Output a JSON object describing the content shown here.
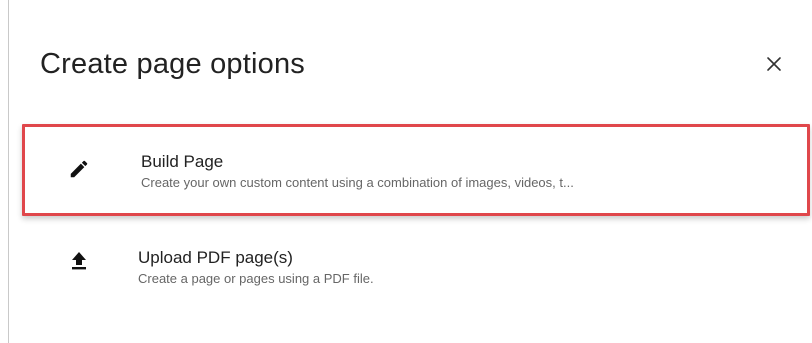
{
  "dialog": {
    "title": "Create page options",
    "close_icon": "close-icon"
  },
  "options": [
    {
      "label": "Build Page",
      "description": "Create your own custom content using a combination of images, videos, t...",
      "icon": "pencil-icon",
      "highlighted": true
    },
    {
      "label": "Upload PDF page(s)",
      "description": "Create a page or pages using a PDF file.",
      "icon": "upload-icon",
      "highlighted": false
    }
  ],
  "colors": {
    "highlight_border": "#e0474b",
    "text_primary": "#222222",
    "text_secondary": "#666666"
  }
}
